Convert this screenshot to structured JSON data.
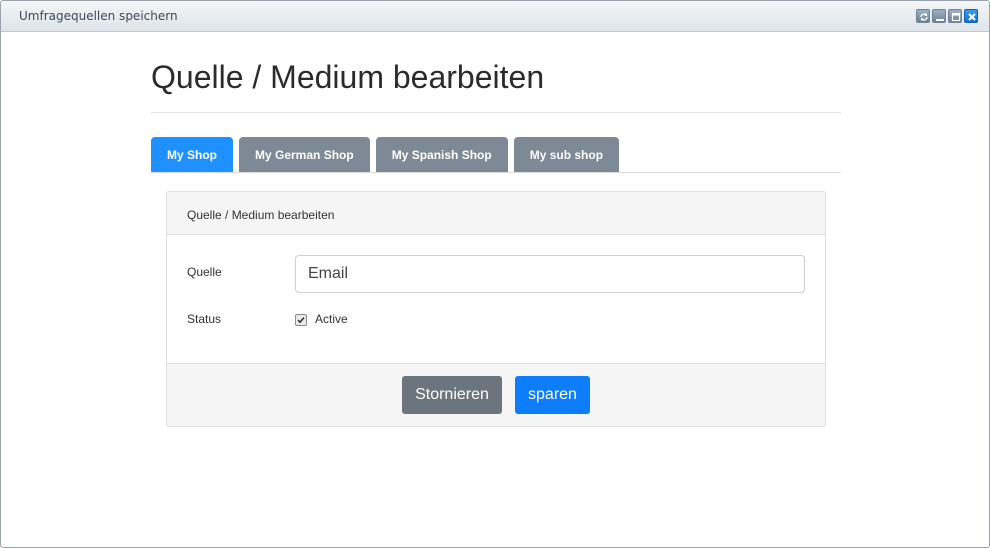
{
  "window": {
    "title": "Umfragequellen speichern",
    "controls": [
      "refresh-icon",
      "minimize-icon",
      "maximize-icon",
      "close-icon"
    ]
  },
  "page": {
    "title": "Quelle / Medium bearbeiten"
  },
  "tabs": [
    {
      "label": "My Shop",
      "active": true
    },
    {
      "label": "My German Shop",
      "active": false
    },
    {
      "label": "My Spanish Shop",
      "active": false
    },
    {
      "label": "My sub shop",
      "active": false
    }
  ],
  "panel": {
    "heading": "Quelle / Medium bearbeiten",
    "fields": {
      "source_label": "Quelle",
      "source_value": "Email",
      "status_label": "Status",
      "status_checked": true,
      "status_option": "Active"
    },
    "buttons": {
      "cancel": "Stornieren",
      "save": "sparen"
    }
  },
  "colors": {
    "active_tab": "#1e90ff",
    "inactive_tab": "#7d8995",
    "save_button": "#0d7dfc",
    "cancel_button": "#6c757d"
  }
}
